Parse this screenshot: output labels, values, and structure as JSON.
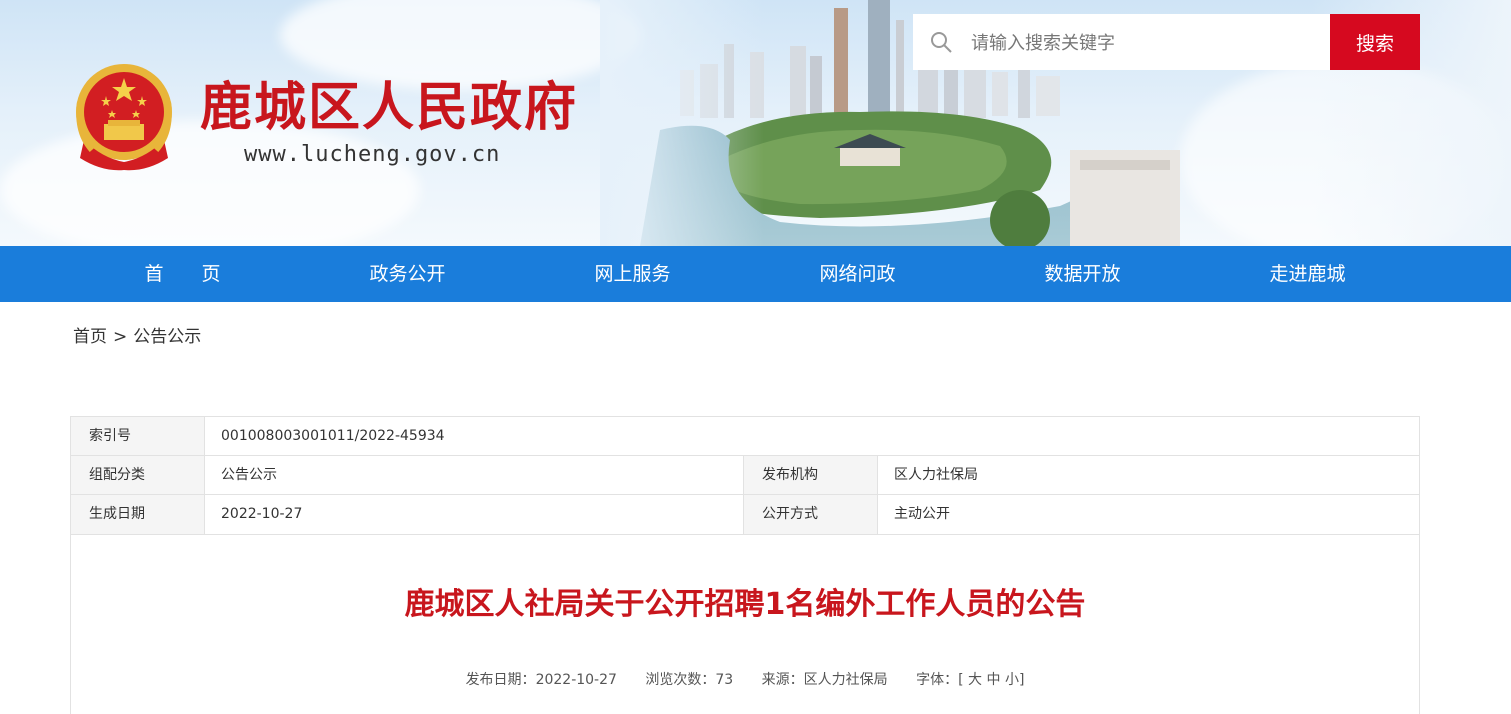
{
  "header": {
    "site_title": "鹿城区人民政府",
    "site_url": "www.lucheng.gov.cn"
  },
  "search": {
    "placeholder": "请输入搜索关键字",
    "value": "",
    "button_label": "搜索"
  },
  "nav": {
    "items": [
      {
        "label": "首　　页"
      },
      {
        "label": "政务公开"
      },
      {
        "label": "网上服务"
      },
      {
        "label": "网络问政"
      },
      {
        "label": "数据开放"
      },
      {
        "label": "走进鹿城"
      }
    ]
  },
  "breadcrumb": {
    "home": "首页",
    "separator": ">",
    "current": "公告公示"
  },
  "meta": {
    "index_label": "索引号",
    "index_value": "001008003001011/2022-45934",
    "category_label": "组配分类",
    "category_value": "公告公示",
    "publisher_label": "发布机构",
    "publisher_value": "区人力社保局",
    "date_label": "生成日期",
    "date_value": "2022-10-27",
    "mode_label": "公开方式",
    "mode_value": "主动公开"
  },
  "article": {
    "title": "鹿城区人社局关于公开招聘1名编外工作人员的公告",
    "publish_date_label": "发布日期：",
    "publish_date": "2022-10-27",
    "views_label": "浏览次数：",
    "views": "73",
    "source_label": "来源：",
    "source": "区人力社保局",
    "font_label": "字体：",
    "font_open": "[",
    "font_large": "大",
    "font_medium": "中",
    "font_small": "小",
    "font_close": "]"
  },
  "colors": {
    "brand_red": "#c8161d",
    "nav_blue": "#1a7ddb",
    "search_red": "#d6091f"
  }
}
